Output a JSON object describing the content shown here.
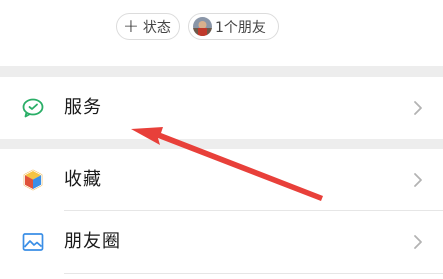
{
  "profile": {
    "status_chip_icon": "plus-icon",
    "status_chip_label": "状态",
    "friends_chip_label": "1个朋友"
  },
  "menu": {
    "items": [
      {
        "label": "服务",
        "icon": "wechat-pay-icon",
        "icon_color": "#2aae67"
      },
      {
        "label": "收藏",
        "icon": "cube-icon",
        "icon_color": "#f0a830"
      },
      {
        "label": "朋友圈",
        "icon": "image-icon",
        "icon_color": "#3a8ee6"
      }
    ],
    "chevron_icon": "chevron-right-icon"
  },
  "annotation": {
    "arrow_color": "#e8403a",
    "points_to": "服务"
  },
  "colors": {
    "background": "#ffffff",
    "separator": "#ededed",
    "text": "#1a1a1a",
    "chevron": "#b3b3b3"
  }
}
